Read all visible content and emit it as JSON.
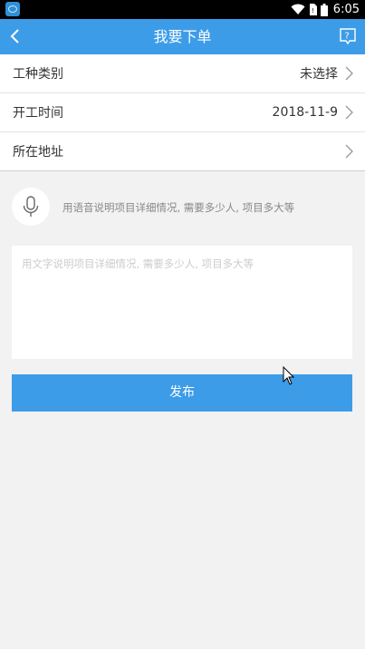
{
  "statusbar": {
    "time": "6:05"
  },
  "header": {
    "title": "我要下单"
  },
  "form": {
    "rows": [
      {
        "label": "工种类别",
        "value": "未选择"
      },
      {
        "label": "开工时间",
        "value": "2018-11-9"
      },
      {
        "label": "所在地址",
        "value": ""
      }
    ]
  },
  "voice": {
    "hint": "用语音说明项目详细情况, 需要多少人, 项目多大等"
  },
  "description": {
    "placeholder": "用文字说明项目详细情况, 需要多少人, 项目多大等"
  },
  "publish": {
    "label": "发布"
  },
  "colors": {
    "primary": "#3d9ce8",
    "background": "#f2f2f2"
  }
}
